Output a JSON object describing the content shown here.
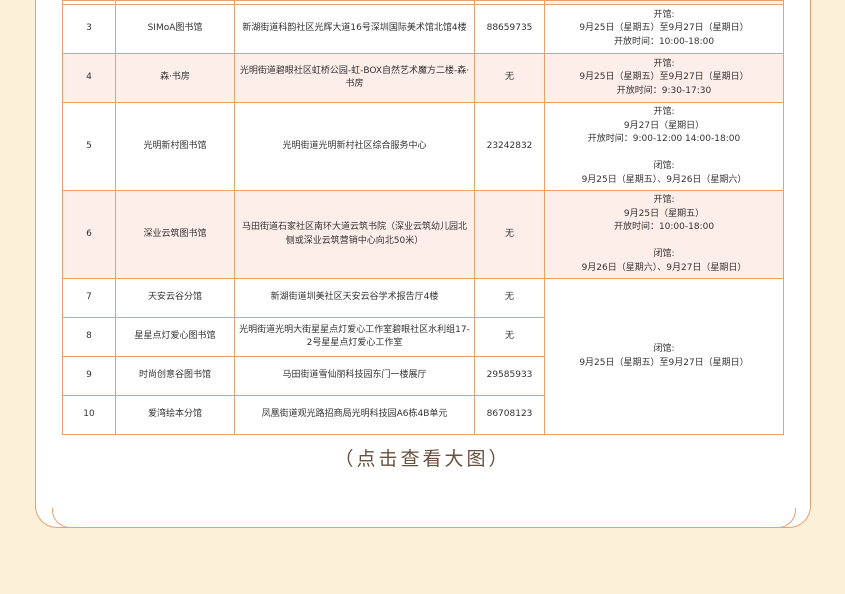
{
  "table": {
    "rows": [
      {
        "no": "3",
        "name": "SIMoA图书馆",
        "address": "新湖街道科韵社区光辉大道16号深圳国际美术馆北馆4楼",
        "phone": "88659735",
        "hours": "开馆:\n9月25日（星期五）至9月27日（星期日）\n开放时间：10:00-18:00",
        "pink": false
      },
      {
        "no": "4",
        "name": "森·书房",
        "address": "光明街道碧眼社区虹桥公园-虹-BOX自然艺术魔方二楼-森·书房",
        "phone": "无",
        "hours": "开馆:\n9月25日（星期五）至9月27日（星期日）\n开放时间：9:30-17:30",
        "pink": true
      },
      {
        "no": "5",
        "name": "光明新村图书馆",
        "address": "光明街道光明新村社区综合服务中心",
        "phone": "23242832",
        "hours": "开馆:\n9月27日（星期日）\n开放时间：9:00-12:00 14:00-18:00\n\n闭馆:\n9月25日（星期五）、9月26日（星期六）",
        "pink": false
      },
      {
        "no": "6",
        "name": "深业云筑图书馆",
        "address": "马田街道石家社区南环大道云筑书院（深业云筑幼儿园北侧或深业云筑营销中心向北50米）",
        "phone": "无",
        "hours": "开馆:\n9月25日（星期五）\n开放时间：10:00-18:00\n\n闭馆:\n9月26日（星期六）、9月27日（星期日）",
        "pink": true
      },
      {
        "no": "7",
        "name": "天安云谷分馆",
        "address": "新湖街道圳美社区天安云谷学术报告厅4楼",
        "phone": "无",
        "pink": false
      },
      {
        "no": "8",
        "name": "星星点灯爱心图书馆",
        "address": "光明街道光明大街星星点灯爱心工作室碧眼社区水利组17-2号星星点灯爱心工作室",
        "phone": "无",
        "pink": false
      },
      {
        "no": "9",
        "name": "时尚创意谷图书馆",
        "address": "马田街道雪仙丽科技园东门一楼展厅",
        "phone": "29585933",
        "pink": false
      },
      {
        "no": "10",
        "name": "爱湾绘本分馆",
        "address": "凤凰街道观光路招商局光明科技园A6栋4B单元",
        "phone": "86708123",
        "pink": false
      }
    ],
    "merged_hours": "闭馆:\n9月25日（星期五）至9月27日（星期日）"
  },
  "caption": "（点击查看大图）",
  "colors": {
    "background": "#fdf0d9",
    "border": "#e9a070",
    "pink_row": "#fdeeea",
    "caption": "#6a4f3c"
  }
}
